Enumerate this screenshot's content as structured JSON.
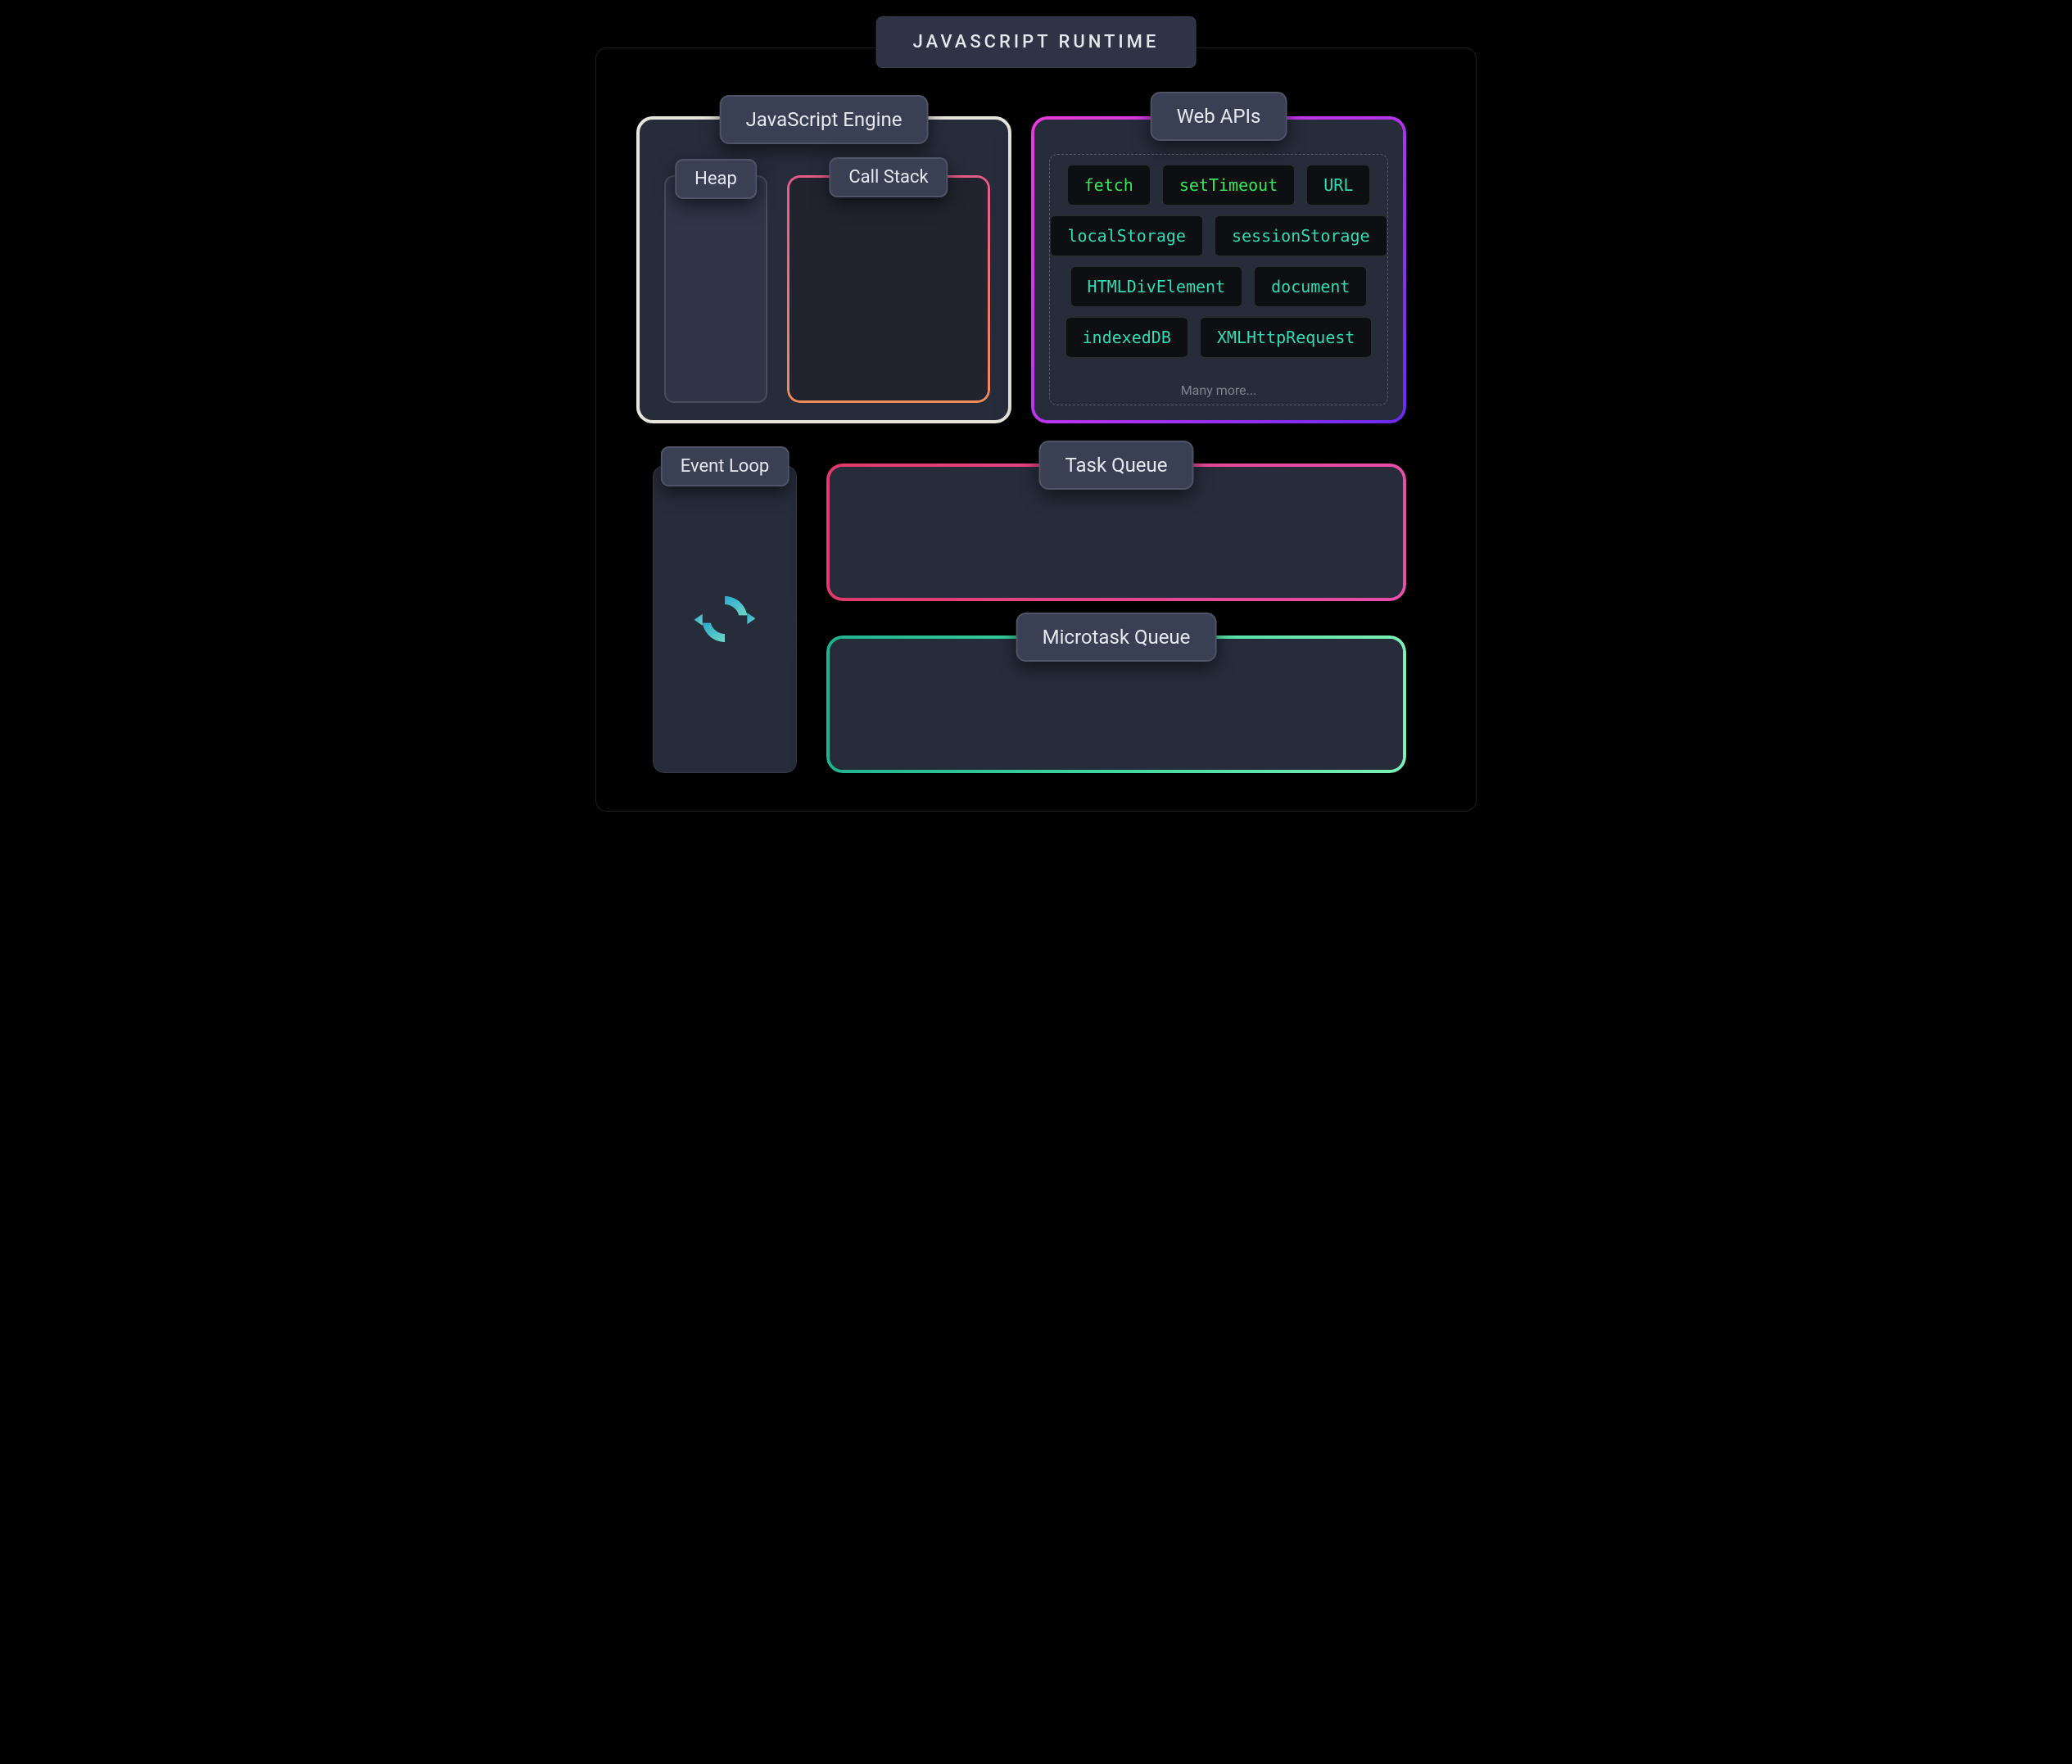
{
  "title": "JAVASCRIPT RUNTIME",
  "engine": {
    "label": "JavaScript Engine",
    "heap_label": "Heap",
    "callstack_label": "Call Stack"
  },
  "webapi": {
    "label": "Web APIs",
    "items_row1": [
      "fetch",
      "setTimeout",
      "URL"
    ],
    "items_row2": [
      "localStorage",
      "sessionStorage"
    ],
    "items_row3": [
      "HTMLDivElement",
      "document"
    ],
    "items_row4": [
      "indexedDB",
      "XMLHttpRequest"
    ],
    "more_label": "Many more..."
  },
  "eventloop": {
    "label": "Event Loop"
  },
  "taskqueue": {
    "label": "Task Queue"
  },
  "microqueue": {
    "label": "Microtask Queue"
  },
  "colors": {
    "bg": "#000000",
    "panel": "#272c3b",
    "pill": "#3a4054",
    "engine_border": "#e8e5dd",
    "callstack_grad_top": "#e85a8a",
    "callstack_grad_bottom": "#f08c5a",
    "webapi_grad_a": "#e93be0",
    "webapi_grad_b": "#6a2bf2",
    "taskqueue_grad_a": "#e23a6a",
    "taskqueue_grad_b": "#e84fab",
    "microqueue_grad_a": "#1fb38e",
    "microqueue_grad_b": "#7df0b6",
    "api_text_teal": "#2fdcb4",
    "api_text_green": "#38e65a"
  }
}
